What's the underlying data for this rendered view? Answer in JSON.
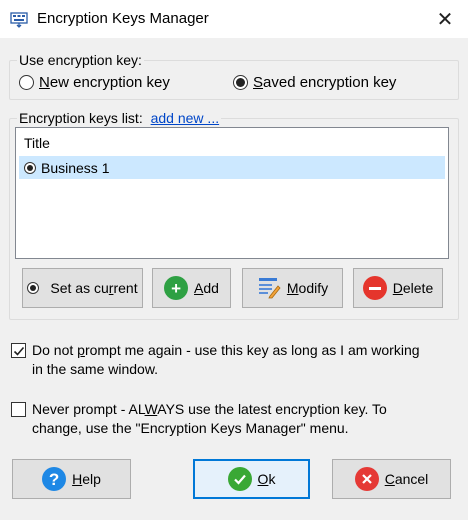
{
  "window": {
    "title": "Encryption Keys Manager",
    "close_glyph": "✕"
  },
  "use_key": {
    "label": "Use encryption key:",
    "options": [
      {
        "prefix": "",
        "accel": "N",
        "rest": "ew encryption key",
        "selected": false
      },
      {
        "prefix": "",
        "accel": "S",
        "rest": "aved encryption key",
        "selected": true
      }
    ]
  },
  "keys_list": {
    "label": "Encryption keys list:",
    "add_link": "add new ...",
    "column_header": "Title",
    "rows": [
      {
        "title": "Business 1",
        "current": true
      }
    ]
  },
  "buttons": {
    "set_current": {
      "prefix": "Set as cu",
      "accel": "r",
      "rest": "rent"
    },
    "add": {
      "prefix": "",
      "accel": "A",
      "rest": "dd"
    },
    "modify": {
      "prefix": "",
      "accel": "M",
      "rest": "odify"
    },
    "delete": {
      "prefix": "",
      "accel": "D",
      "rest": "elete"
    },
    "help": {
      "prefix": "",
      "accel": "H",
      "rest": "elp"
    },
    "ok": {
      "prefix": "",
      "accel": "O",
      "rest": "k"
    },
    "cancel": {
      "prefix": "",
      "accel": "C",
      "rest": "ancel"
    }
  },
  "options": {
    "dont_prompt": {
      "checked": true,
      "line1_prefix": "Do not ",
      "line1_accel": "p",
      "line1_rest": "rompt me again - use this key as long as I am working",
      "line2": "in the same window."
    },
    "never_prompt": {
      "checked": false,
      "line1_prefix": "Never prompt - AL",
      "line1_accel": "W",
      "line1_rest": "AYS use the latest encryption key.  To",
      "line2": "change, use the \"Encryption Keys Manager\" menu."
    }
  },
  "colors": {
    "accent": "#0078d7",
    "selection": "#cce8ff",
    "add_green": "#2ea043",
    "delete_red": "#e5352c",
    "help_blue": "#1e88e5",
    "ok_green": "#3aa835",
    "cancel_red": "#e53935"
  },
  "icons": {
    "title": "keyboard-keys-icon",
    "add": "plus-circle-icon",
    "modify": "edit-list-icon",
    "delete": "minus-circle-icon",
    "help": "question-circle-icon",
    "ok": "check-circle-icon",
    "cancel": "x-circle-icon"
  }
}
